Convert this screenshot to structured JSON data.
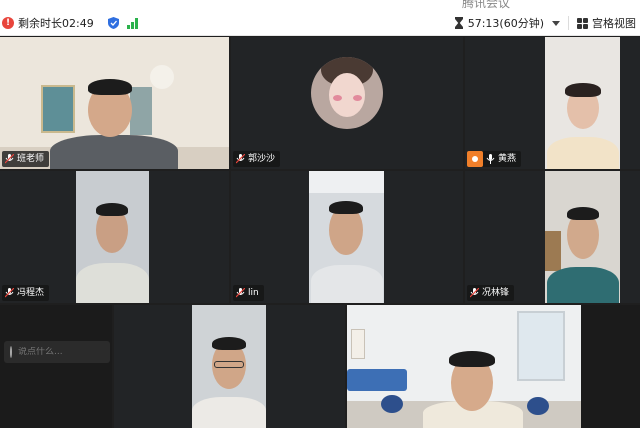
{
  "app": {
    "title": "腾讯会议"
  },
  "toolbar": {
    "remaining_label": "剩余时长02:49",
    "duration_label": "57:13(60分钟)",
    "view_label": "宫格视图",
    "icons": {
      "alert": "alert-icon",
      "security": "shield-icon",
      "network": "signal-icon",
      "timer": "hourglass-icon",
      "view": "grid-icon"
    }
  },
  "participants": [
    {
      "name": "班老师"
    },
    {
      "name": "郭沙沙"
    },
    {
      "name": "黄燕"
    },
    {
      "name": "冯程杰"
    },
    {
      "name": "lin"
    },
    {
      "name": "况林锋"
    }
  ],
  "chat": {
    "placeholder": "说点什么..."
  },
  "colors": {
    "background": "#1f1f1f",
    "tile": "#222426",
    "accent_orange": "#f07f2a",
    "signal_green": "#2bb24c",
    "alert_red": "#e8453c"
  }
}
